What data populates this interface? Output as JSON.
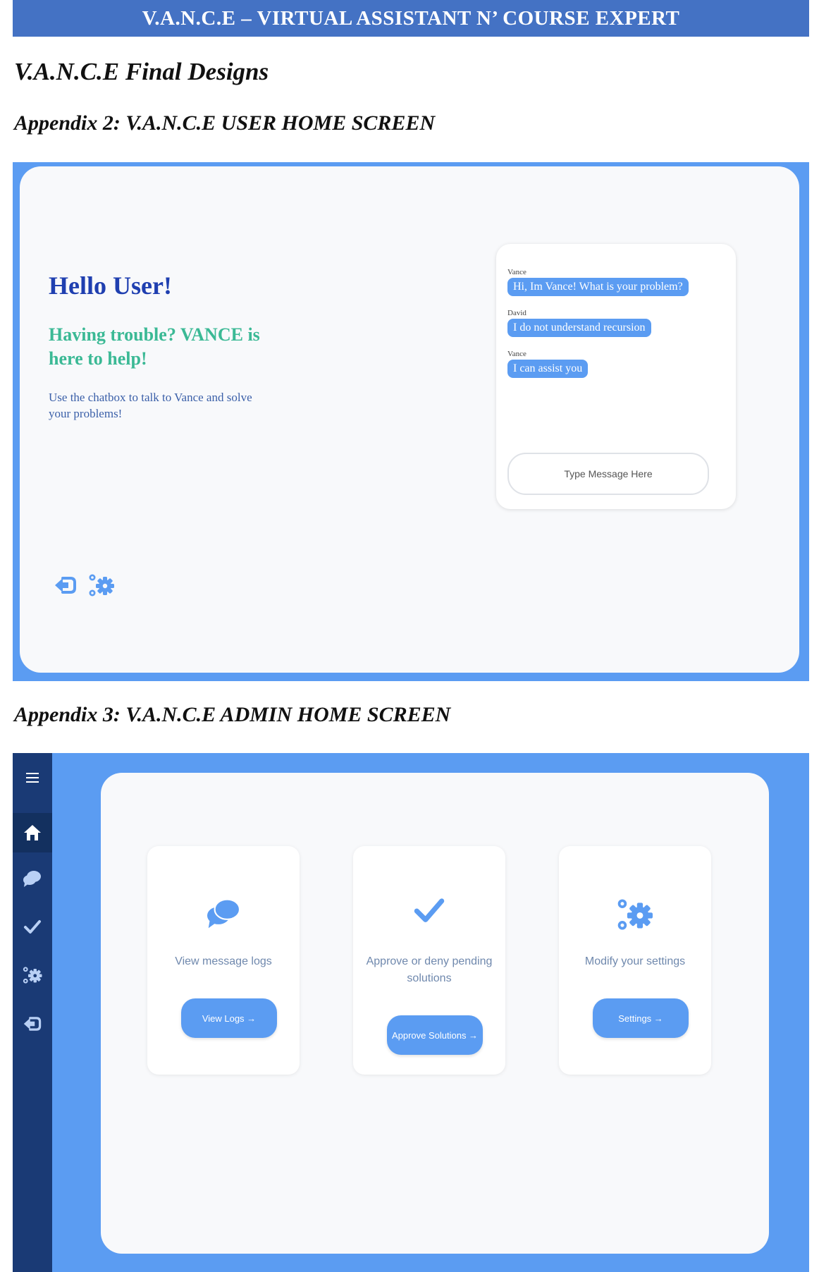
{
  "document": {
    "banner": "V.A.N.C.E – VIRTUAL ASSISTANT N’ COURSE EXPERT",
    "heading": "V.A.N.C.E Final Designs",
    "appendix2_caption": "Appendix 2: V.A.N.C.E USER HOME SCREEN",
    "appendix3_caption": "Appendix 3: V.A.N.C.E ADMIN HOME SCREEN"
  },
  "user_screen": {
    "greeting": "Hello User!",
    "subheading": "Having trouble? VANCE is here to help!",
    "description": "Use the chatbox to talk to Vance and solve your problems!",
    "chat": {
      "messages": [
        {
          "sender": "Vance",
          "text": "Hi, Im Vance! What is your problem?"
        },
        {
          "sender": "David",
          "text": "I do not understand recursion"
        },
        {
          "sender": "Vance",
          "text": "I can assist you"
        }
      ],
      "input_placeholder": "Type Message Here"
    },
    "icons": [
      "logout-icon",
      "settings-gears-icon"
    ]
  },
  "admin_screen": {
    "sidebar_icons": [
      "menu-icon",
      "home-icon",
      "chat-icon",
      "check-icon",
      "settings-gears-icon",
      "logout-icon"
    ],
    "active_sidebar_item": "home-icon",
    "cards": [
      {
        "icon": "chat-icon",
        "text": "View message logs",
        "button": "View Logs →"
      },
      {
        "icon": "check-icon",
        "text": "Approve or deny pending solutions",
        "button": "Approve Solutions →"
      },
      {
        "icon": "settings-gears-icon",
        "text": "Modify your settings",
        "button": "Settings →"
      }
    ]
  },
  "colors": {
    "banner": "#4472c4",
    "frame_blue": "#5b9cf2",
    "sidebar_navy": "#1a3a75",
    "greeting_blue": "#1f3fb0",
    "subheading_green": "#3bb995",
    "panel_background": "#f8f9fb"
  }
}
